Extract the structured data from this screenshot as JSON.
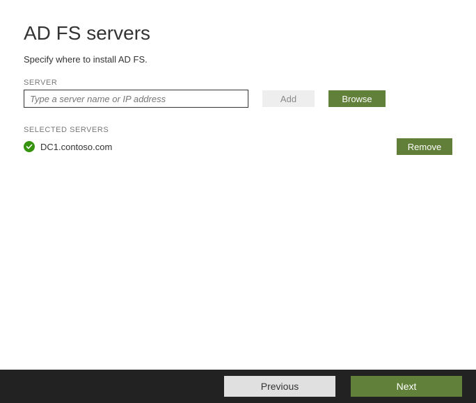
{
  "page": {
    "title": "AD FS servers",
    "subtitle": "Specify where to install AD FS."
  },
  "server_input": {
    "label": "SERVER",
    "placeholder": "Type a server name or IP address",
    "value": ""
  },
  "buttons": {
    "add": "Add",
    "browse": "Browse",
    "remove": "Remove",
    "previous": "Previous",
    "next": "Next"
  },
  "selected": {
    "label": "SELECTED SERVERS",
    "items": [
      {
        "name": "DC1.contoso.com",
        "status": "ok"
      }
    ]
  },
  "colors": {
    "accent": "#618039",
    "success": "#36930D",
    "footer": "#222222"
  }
}
